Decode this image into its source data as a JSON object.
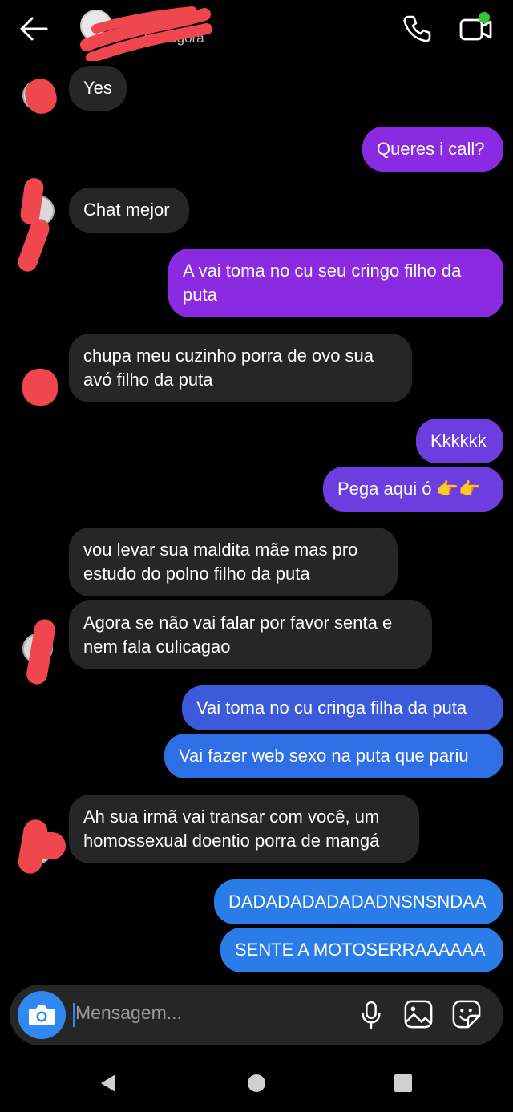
{
  "header": {
    "status_text": "line agora",
    "icons": [
      "back-arrow-icon",
      "phone-call-icon",
      "video-call-icon"
    ]
  },
  "messages": [
    {
      "from": "them",
      "text": "Yes"
    },
    {
      "from": "me",
      "text": "Queres i call?"
    },
    {
      "from": "them",
      "text": "Chat mejor"
    },
    {
      "from": "me",
      "text": "A vai toma no cu seu cringo filho da puta"
    },
    {
      "from": "them",
      "text": "chupa meu cuzinho porra de ovo sua avó filho da puta"
    },
    {
      "from": "me",
      "text": "Kkkkkk"
    },
    {
      "from": "me",
      "text": "Pega aqui ó 👉👉"
    },
    {
      "from": "them",
      "text": "vou levar sua maldita mãe mas pro estudo do polno filho da puta"
    },
    {
      "from": "them",
      "text": "Agora se não vai falar por favor senta e nem fala culicagao"
    },
    {
      "from": "me",
      "text": "Vai toma no cu cringa filha da puta"
    },
    {
      "from": "me",
      "text": "Vai fazer web sexo na puta que pariu"
    },
    {
      "from": "them",
      "text": "Ah sua irmã vai transar com você, um homossexual doentio porra de mangá"
    },
    {
      "from": "me",
      "text": "DADADADADADADNSNSNDAA"
    },
    {
      "from": "me",
      "text": "SENTE A MOTOSERRAAAAAA"
    }
  ],
  "composer": {
    "placeholder": "Mensagem...",
    "icons": [
      "camera-icon",
      "microphone-icon",
      "gallery-icon",
      "sticker-icon"
    ]
  },
  "colors": {
    "background": "#000000",
    "incoming_bubble": "#262626",
    "outgoing_purple": "#8a2be2",
    "outgoing_blue": "#2a7de8",
    "redaction": "#f0474e",
    "online": "#3ac13a"
  }
}
